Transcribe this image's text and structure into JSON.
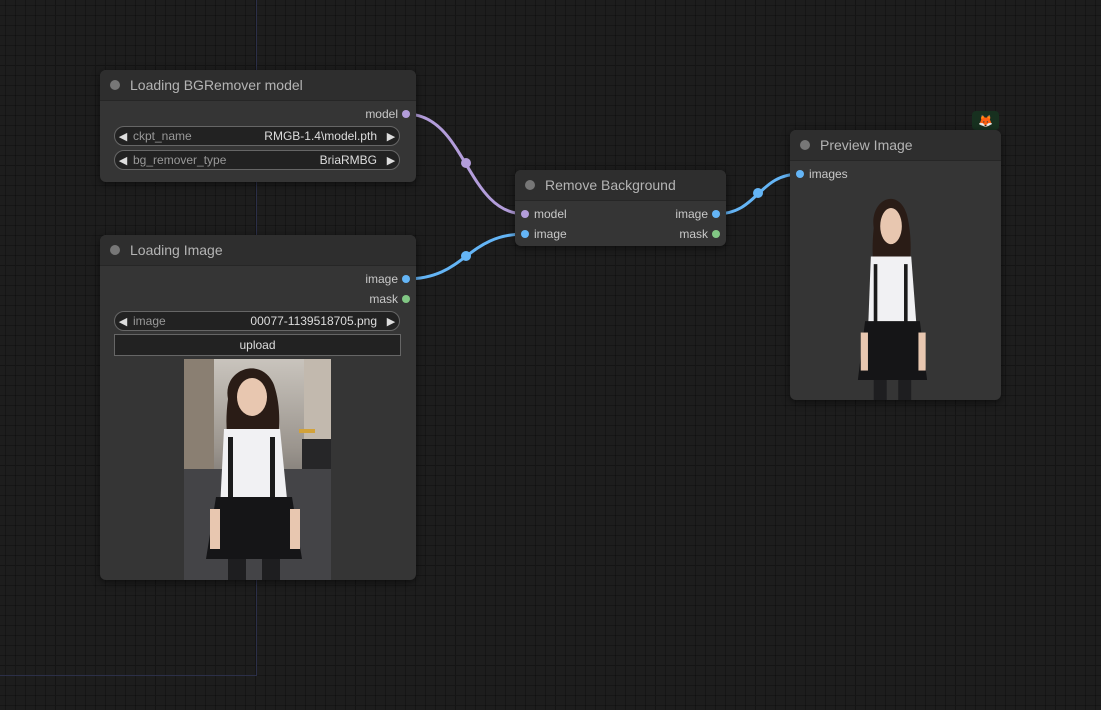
{
  "nodes": {
    "bg_model": {
      "title": "Loading BGRemover model",
      "output_model": "model",
      "widgets": [
        {
          "name": "ckpt_name",
          "value": "RMGB-1.4\\model.pth"
        },
        {
          "name": "bg_remover_type",
          "value": "BriaRMBG"
        }
      ]
    },
    "load_image": {
      "title": "Loading Image",
      "output_image": "image",
      "output_mask": "mask",
      "widget": {
        "name": "image",
        "value": "00077-1139518705.png"
      },
      "upload_label": "upload"
    },
    "remove_bg": {
      "title": "Remove Background",
      "input_model": "model",
      "input_image": "image",
      "output_image": "image",
      "output_mask": "mask"
    },
    "preview": {
      "title": "Preview Image",
      "input_images": "images"
    }
  },
  "badge": {
    "icon": "fox-icon",
    "glyph": "🦊"
  },
  "colors": {
    "model_link": "#b39ddb",
    "image_link": "#64b5f6",
    "mask_slot": "#81c784",
    "node_bg": "#353535",
    "title_bg": "#2e2e2e"
  }
}
